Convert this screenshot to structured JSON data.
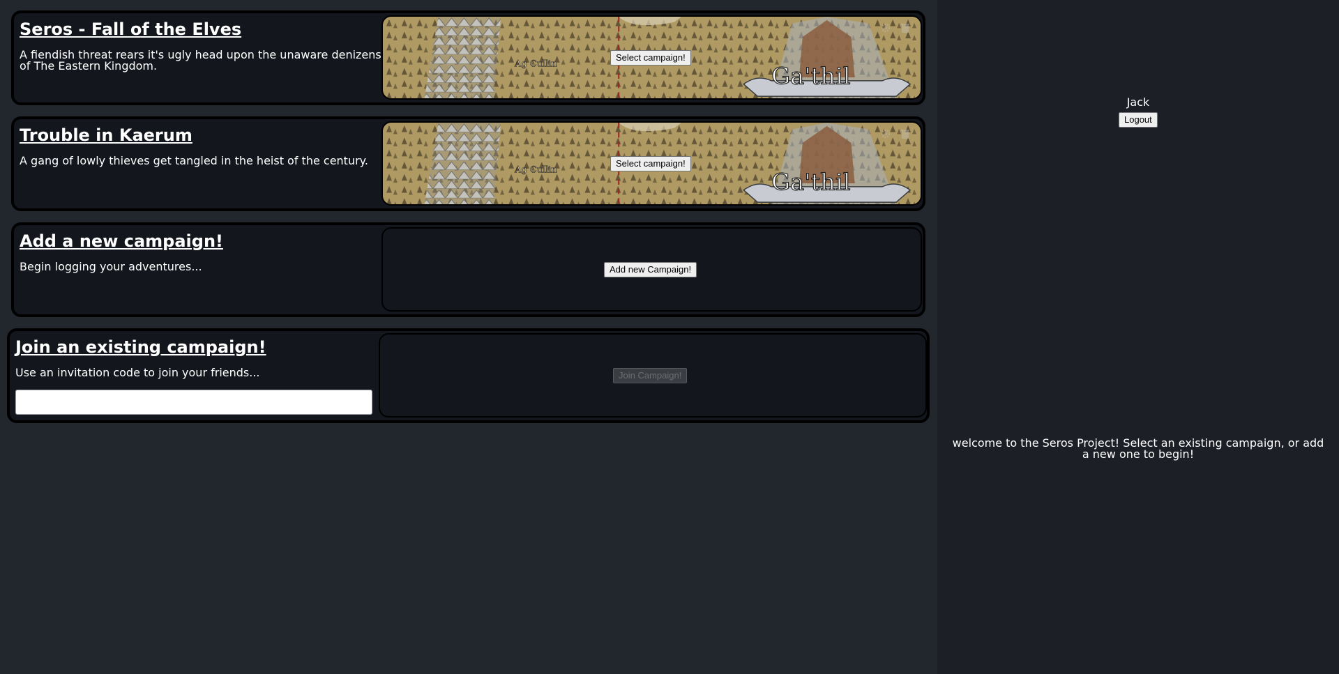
{
  "campaigns": [
    {
      "title": "Seros - Fall of the Elves",
      "description": "A fiendish threat rears it's ugly head upon the unaware denizens of The Eastern Kingdom.",
      "button": "Select campaign!",
      "map_labels": [
        "Ag Cullin",
        "Ga'thil"
      ]
    },
    {
      "title": "Trouble in Kaerum",
      "description": "A gang of lowly thieves get tangled in the heist of the century.",
      "button": "Select campaign!",
      "map_labels": [
        "Ag Cullin",
        "Ga'thil"
      ]
    }
  ],
  "add_campaign": {
    "title": "Add a new campaign!",
    "description": "Begin logging your adventures...",
    "button": "Add new Campaign!"
  },
  "join_campaign": {
    "title": "Join an existing campaign!",
    "description": "Use an invitation code to join your friends...",
    "input_value": "",
    "button": "Join Campaign!"
  },
  "sidebar": {
    "username": "Jack",
    "logout": "Logout",
    "welcome": "welcome to the Seros Project! Select an existing campaign, or add a new one to begin!"
  },
  "icons": [
    "gear-icon",
    "trash-icon"
  ],
  "colors": {
    "page_bg": "#22272e",
    "card_bg": "#13171d",
    "sidebar_bg": "#1c2026",
    "map_parchment": "#b09a63"
  }
}
